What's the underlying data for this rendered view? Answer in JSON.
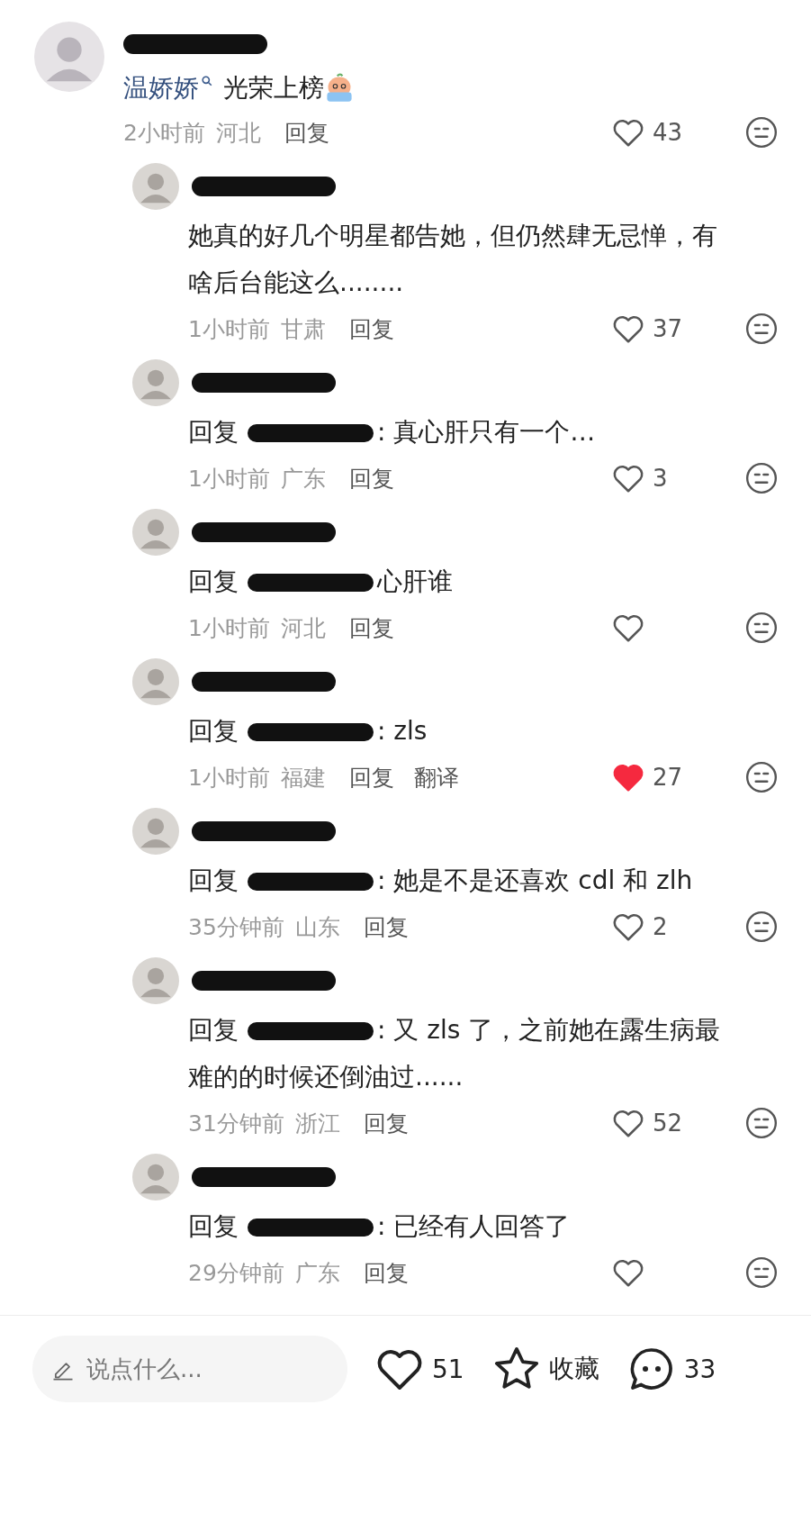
{
  "comment": {
    "mention": "温娇娇",
    "text": "光荣上榜",
    "time": "2小时前",
    "location": "河北",
    "reply_action": "回复",
    "liked": false,
    "likes": "43",
    "replies": [
      {
        "text": "她真的好几个明星都告她，但仍然肆无忌惮，有啥后台能这么........",
        "time": "1小时前",
        "location": "甘肃",
        "reply_action": "回复",
        "liked": false,
        "likes": "37"
      },
      {
        "reply_prefix": "回复",
        "text": ": 真心肝只有一个…",
        "time": "1小时前",
        "location": "广东",
        "reply_action": "回复",
        "liked": false,
        "likes": "3"
      },
      {
        "reply_prefix": "回复",
        "text": "心肝谁",
        "time": "1小时前",
        "location": "河北",
        "reply_action": "回复",
        "liked": false
      },
      {
        "reply_prefix": "回复",
        "text": ": zls",
        "time": "1小时前",
        "location": "福建",
        "reply_action": "回复",
        "translate_action": "翻译",
        "liked": true,
        "likes": "27"
      },
      {
        "reply_prefix": "回复",
        "text": ": 她是不是还喜欢 cdl 和 zlh",
        "time": "35分钟前",
        "location": "山东",
        "reply_action": "回复",
        "liked": false,
        "likes": "2"
      },
      {
        "reply_prefix": "回复",
        "text": ": 又 zls 了，之前她在露生病最难的的时候还倒油过......",
        "time": "31分钟前",
        "location": "浙江",
        "reply_action": "回复",
        "liked": false,
        "likes": "52"
      },
      {
        "reply_prefix": "回复",
        "text": ": 已经有人回答了",
        "time": "29分钟前",
        "location": "广东",
        "reply_action": "回复",
        "liked": false
      }
    ]
  },
  "bottom_bar": {
    "placeholder": "说点什么...",
    "likes": "51",
    "collect_label": "收藏",
    "comments": "33"
  }
}
